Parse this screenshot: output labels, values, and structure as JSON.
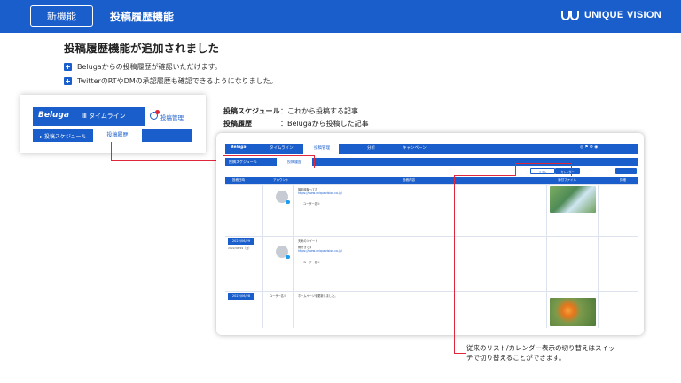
{
  "header": {
    "badge": "新機能",
    "title": "投稿履歴機能",
    "brand": "UNIQUE VISION",
    "bg": "#1a5ecb"
  },
  "headline": "投稿履歴機能が追加されました",
  "bullets": [
    "Belugaからの投稿履歴が確認いただけます。",
    "TwitterのRTやDMの承認履歴も確認できるようになりました。"
  ],
  "zoom": {
    "brand": "Beluga",
    "timeline": "タイムライン",
    "post_mgmt": "投稿管理",
    "sub_schedule": "投稿スケジュール",
    "sub_history": "投稿履歴"
  },
  "definitions": [
    {
      "term": "投稿スケジュール",
      "desc": "：これから投稿する記事"
    },
    {
      "term": "投稿履歴",
      "desc": "：Belugaから投稿した記事"
    }
  ],
  "screenshot": {
    "brand": "Beluga",
    "nav": [
      "タイムライン",
      "投稿管理",
      "分析",
      "キャンペーン"
    ],
    "sub_schedule": "投稿スケジュール",
    "sub_history": "投稿履歴",
    "toggle_list": "リスト",
    "toggle_calendar": "カレンダー",
    "columns": [
      "投稿日時",
      "アカウント",
      "投稿内容",
      "添付ファイル",
      "詳細"
    ],
    "rows": [
      {
        "date": "",
        "title": "撮影時撮ってた",
        "link": "https://www.uniquevision.co.jp/",
        "user": "ユーザー名①"
      },
      {
        "date": "2022/06/29",
        "weekday": "2022/06/29（金）",
        "title": "天気のツイート",
        "body": "雨好きです",
        "link": "https://www.uniquevision.co.jp/",
        "user": "ユーザー名①"
      },
      {
        "date": "2022/06/28",
        "title": "ホームページを更新しました。",
        "user": "ユーザー名①"
      }
    ]
  },
  "note": "従来のリスト/カレンダー表示の切り替えはスイッチで切り替えることができます。",
  "colors": {
    "accent": "#1a5ecb",
    "highlight": "#e0263a"
  }
}
